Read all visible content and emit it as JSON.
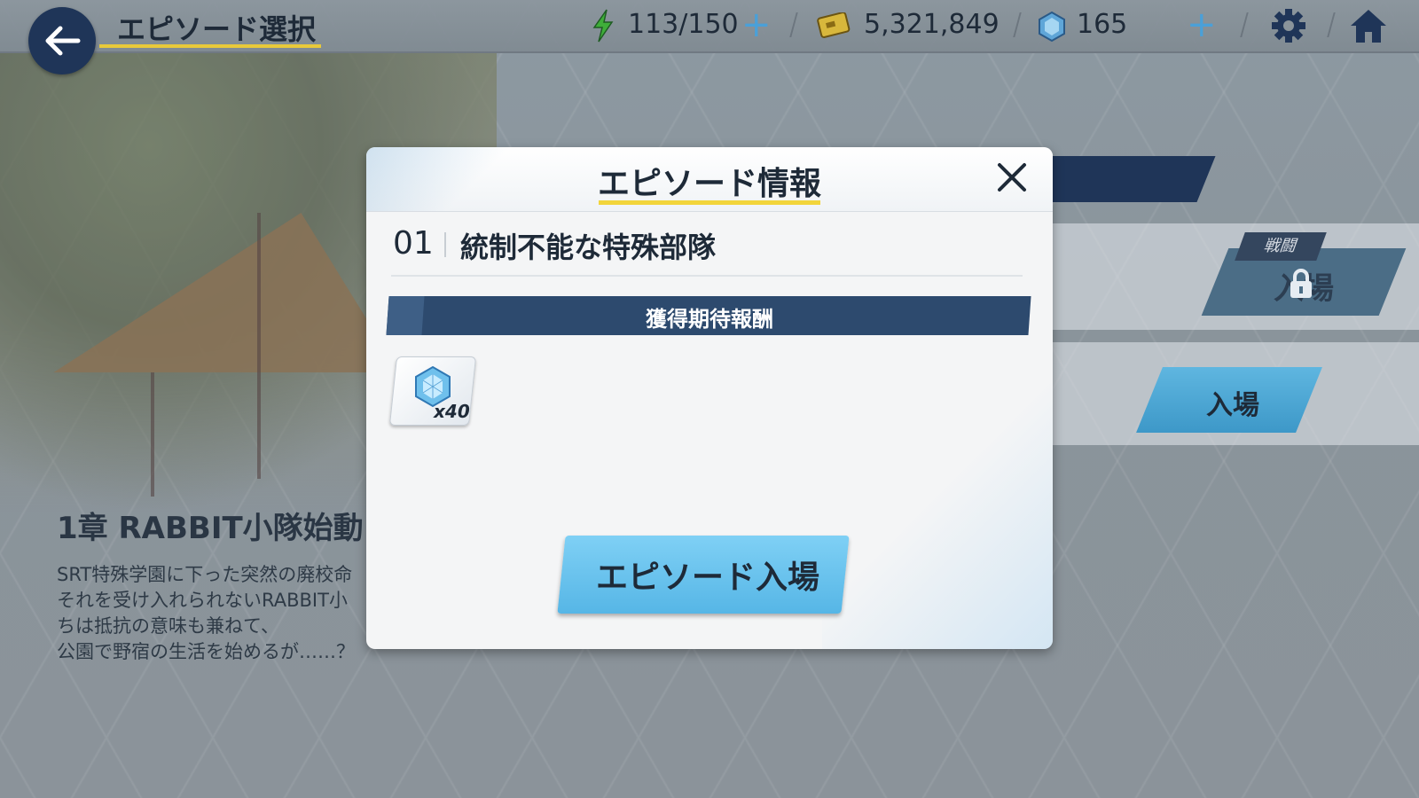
{
  "header": {
    "title": "エピソード選択",
    "ap": "113/150",
    "credits": "5,321,849",
    "gems": "165"
  },
  "icons": {
    "back": "arrow-left-icon",
    "ap": "lightning-icon",
    "credits": "credit-card-icon",
    "gems": "gem-icon",
    "settings": "gear-icon",
    "home": "home-icon"
  },
  "stage_list": {
    "battle_tag": "戦闘",
    "locked_enter": "入場",
    "enter": "入場"
  },
  "chapter": {
    "title": "1章 RABBIT小隊始動",
    "description": "SRT特殊学園に下った突然の廃校命\nそれを受け入れられないRABBIT小\nちは抵抗の意味も兼ねて、\n公園で野宿の生活を始めるが……？"
  },
  "modal": {
    "title": "エピソード情報",
    "episode_number": "01",
    "episode_name": "統制不能な特殊部隊",
    "reward_header": "獲得期待報酬",
    "rewards": [
      {
        "icon": "gem-icon",
        "quantity": "x40"
      }
    ],
    "enter_button": "エピソード入場"
  },
  "colors": {
    "navy": "#1f3558",
    "accent_yellow": "#f2d53c",
    "button_blue": "#56b6e6",
    "ap_green": "#3fae3a"
  }
}
